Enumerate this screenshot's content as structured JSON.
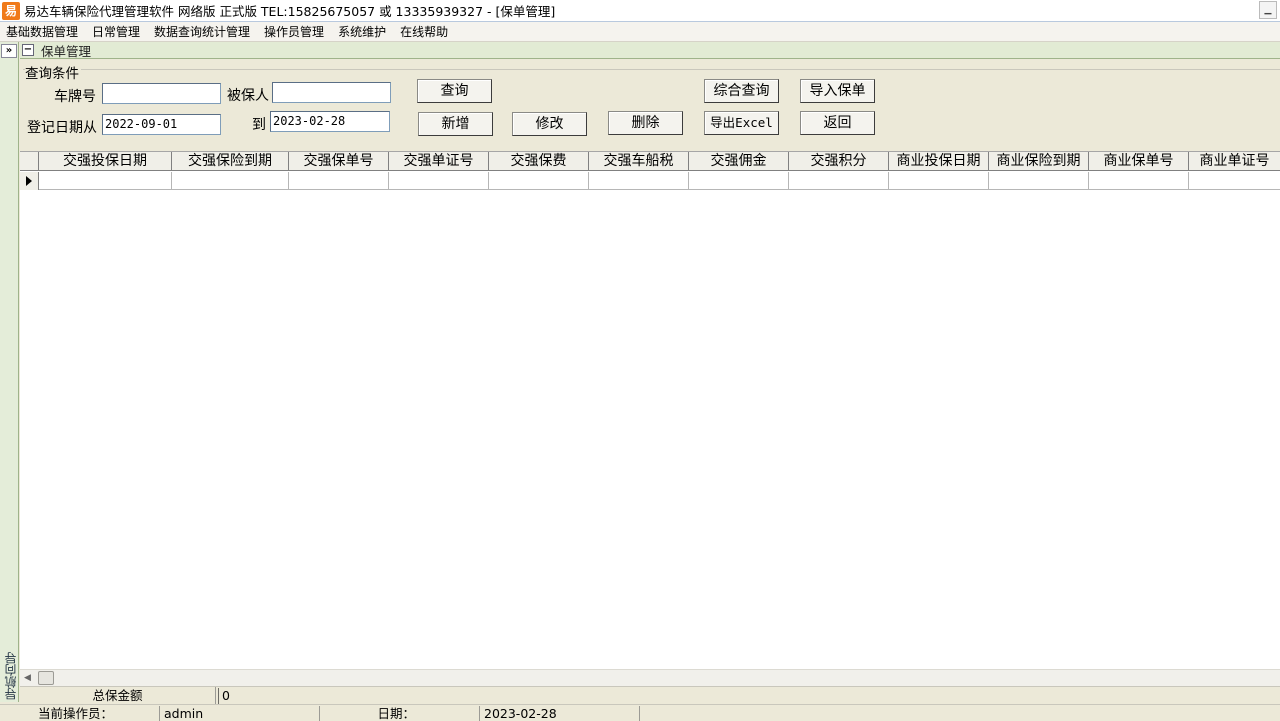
{
  "window": {
    "app_icon": "易",
    "title": "易达车辆保险代理管理软件 网络版 正式版 TEL:15825675057 或 13335939327 - [保单管理]"
  },
  "menu": [
    "基础数据管理",
    "日常管理",
    "数据查询统计管理",
    "操作员管理",
    "系统维护",
    "在线帮助"
  ],
  "sidebar": {
    "expand_label": "»",
    "nav_label": "导航向导"
  },
  "panel": {
    "title": "保单管理",
    "collapse_label": "−"
  },
  "query": {
    "group_title": "查询条件",
    "plate_label": "车牌号",
    "plate_value": "",
    "insured_label": "被保人",
    "insured_value": "",
    "date_from_label": "登记日期从",
    "date_from_value": "2022-09-01",
    "date_to_label": "到",
    "date_to_value": "2023-02-28"
  },
  "buttons": {
    "search": "查询",
    "add": "新增",
    "edit": "修改",
    "delete": "删除",
    "combined_search": "综合查询",
    "import": "导入保单",
    "export": "导出Excel",
    "back": "返回"
  },
  "grid": {
    "columns": [
      "交强投保日期",
      "交强保险到期",
      "交强保单号",
      "交强单证号",
      "交强保费",
      "交强车船税",
      "交强佣金",
      "交强积分",
      "商业投保日期",
      "商业保险到期",
      "商业保单号",
      "商业单证号"
    ],
    "rows": []
  },
  "totals": {
    "label": "总保金额",
    "value": "0"
  },
  "status": {
    "operator_label": "当前操作员：",
    "operator_value": "admin",
    "date_label": "日期：",
    "date_value": "2023-02-28"
  }
}
